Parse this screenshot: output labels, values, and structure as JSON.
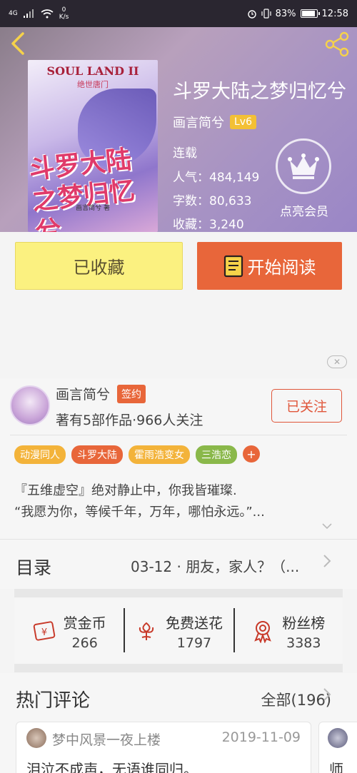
{
  "status_bar": {
    "network": "4G",
    "speed_value": "0",
    "speed_unit": "K/s",
    "battery": "83%",
    "time": "12:58"
  },
  "cover": {
    "en_title": "SOUL LAND II",
    "sub_title": "绝世唐门",
    "title_art": "斗罗大陆之梦归忆兮",
    "author_line": "画言简兮 著"
  },
  "book": {
    "title": "斗罗大陆之梦归忆兮",
    "author": "画言简兮",
    "level": "Lv6",
    "status": "连载",
    "popularity": "人气：484,149",
    "word_count": "字数：80,633",
    "favorites": "收藏：3,240"
  },
  "vip": {
    "label": "点亮会员"
  },
  "buttons": {
    "collected": "已收藏",
    "start_reading": "开始阅读"
  },
  "author_card": {
    "name": "画言简兮",
    "sign_badge": "签约",
    "meta": "著有5部作品·966人关注",
    "follow_label": "已关注",
    "tags": [
      {
        "label": "动漫同人",
        "color": "#f3b33a"
      },
      {
        "label": "斗罗大陆",
        "color": "#e8663a"
      },
      {
        "label": "霍雨浩变女",
        "color": "#f3b33a"
      },
      {
        "label": "三浩恋",
        "color": "#8ab84a"
      }
    ],
    "tag_more": "+",
    "description": [
      "『五维虚空』绝对静止中，你我皆璀璨.",
      "“我愿为你，等候千年，万年，哪怕永远。”..."
    ]
  },
  "toc": {
    "label": "目录",
    "latest": "03-12 · 朋友，家人？（..."
  },
  "actions": [
    {
      "label": "赏金币",
      "count": "266"
    },
    {
      "label": "免费送花",
      "count": "1797"
    },
    {
      "label": "粉丝榜",
      "count": "3383"
    }
  ],
  "comments": {
    "title": "热门评论",
    "all_label": "全部(196)",
    "items": [
      {
        "user": "梦中风景一夜上楼",
        "date": "2019-11-09",
        "text": "泪泣不成声，无语谁同归。"
      },
      {
        "user": "",
        "date": "",
        "text": "师"
      }
    ]
  },
  "colors": {
    "accent_orange": "#e8663a",
    "collected_yellow": "#fbf180",
    "back_arrow": "#f6d24a"
  }
}
